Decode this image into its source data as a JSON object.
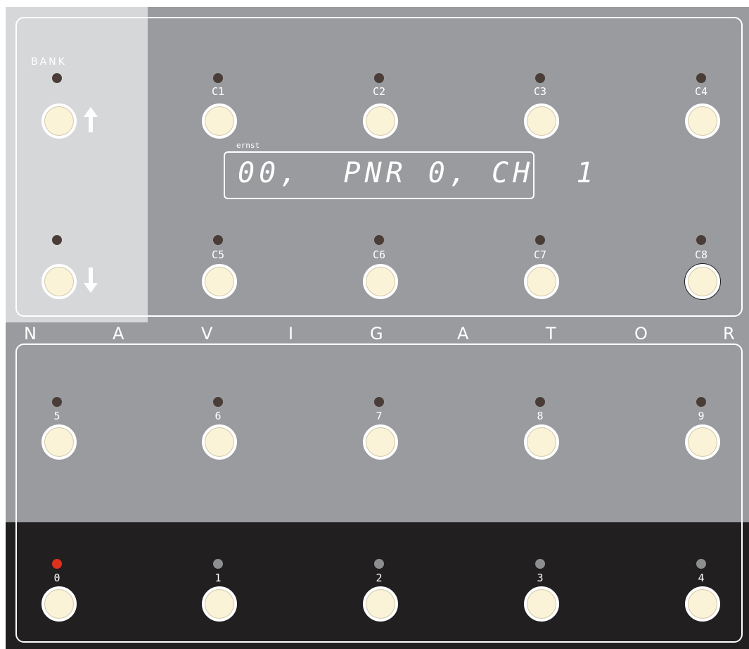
{
  "brand": {
    "letters": [
      "N",
      "A",
      "V",
      "I",
      "G",
      "A",
      "T",
      "O",
      "R"
    ]
  },
  "bank": {
    "label": "BANK",
    "up_icon": "arrow-up-icon",
    "down_icon": "arrow-down-icon"
  },
  "display": {
    "tag": "ernst",
    "text": "00,  PNR 0, CH  1"
  },
  "upper_row": [
    {
      "label": "C1"
    },
    {
      "label": "C2"
    },
    {
      "label": "C3"
    },
    {
      "label": "C4"
    }
  ],
  "middle_row": [
    {
      "label": "C5"
    },
    {
      "label": "C6"
    },
    {
      "label": "C7"
    },
    {
      "label": "C8"
    }
  ],
  "number_row_top": [
    {
      "label": "5"
    },
    {
      "label": "6"
    },
    {
      "label": "7"
    },
    {
      "label": "8"
    },
    {
      "label": "9"
    }
  ],
  "number_row_bottom": [
    {
      "label": "0",
      "active": true
    },
    {
      "label": "1"
    },
    {
      "label": "2"
    },
    {
      "label": "3"
    },
    {
      "label": "4"
    }
  ],
  "colors": {
    "panel_grey": "#9a9b9e",
    "bank_strip": "#d6d7d9",
    "dark_panel": "#221f20",
    "led_off": "#4a3d38",
    "led_active": "#e0301e",
    "button_cream": "#fbf3d8"
  }
}
